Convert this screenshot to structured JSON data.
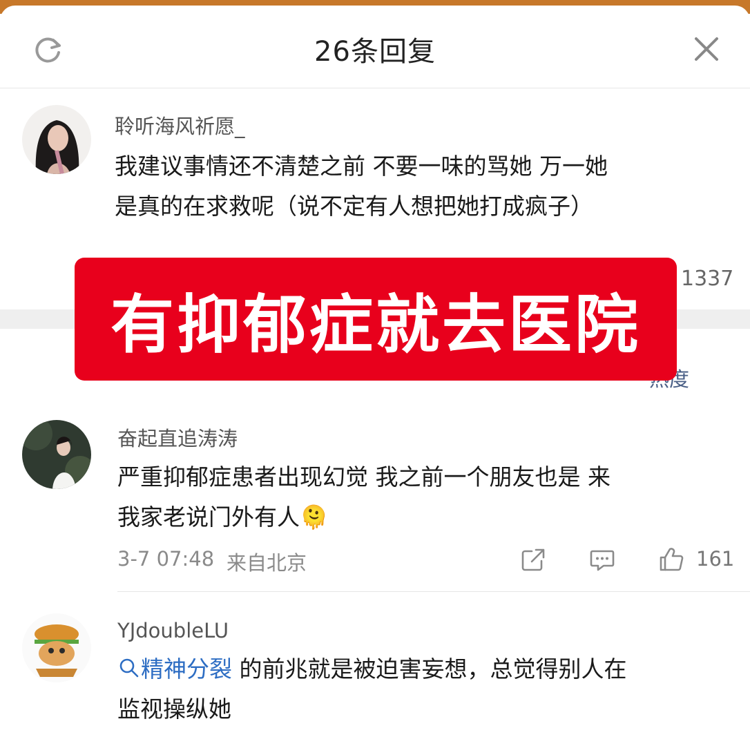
{
  "header": {
    "title": "26条回复"
  },
  "original_comment": {
    "username": "聆听海风祈愿_",
    "text_line1": "我建议事情还不清楚之前 不要一味的骂她 万一她",
    "text_line2": "是真的在求救呢（说不定有人想把她打成疯子）",
    "like_count_partial": "1337"
  },
  "sort": {
    "label": "热度"
  },
  "overlay_banner": {
    "text": "有抑郁症就去医院",
    "bg_color": "#e8001c"
  },
  "replies": [
    {
      "username": "奋起直追涛涛",
      "text_line1": "严重抑郁症患者出现幻觉 我之前一个朋友也是 来",
      "text_line2": "我家老说门外有人",
      "emoji": "🫠",
      "time": "3-7 07:48",
      "location": "来自北京",
      "like_count": "161"
    },
    {
      "username": "YJdoubleLU",
      "topic": "精神分裂",
      "text_line1_rest": " 的前兆就是被迫害妄想，总觉得别人在",
      "text_line2": "监视操纵她"
    }
  ],
  "colors": {
    "link": "#2d6dc3",
    "text": "#1a1a1a",
    "meta": "#8a8a8a"
  },
  "icons": [
    "refresh-icon",
    "close-icon",
    "share-icon",
    "comment-icon",
    "like-icon",
    "search-icon"
  ]
}
